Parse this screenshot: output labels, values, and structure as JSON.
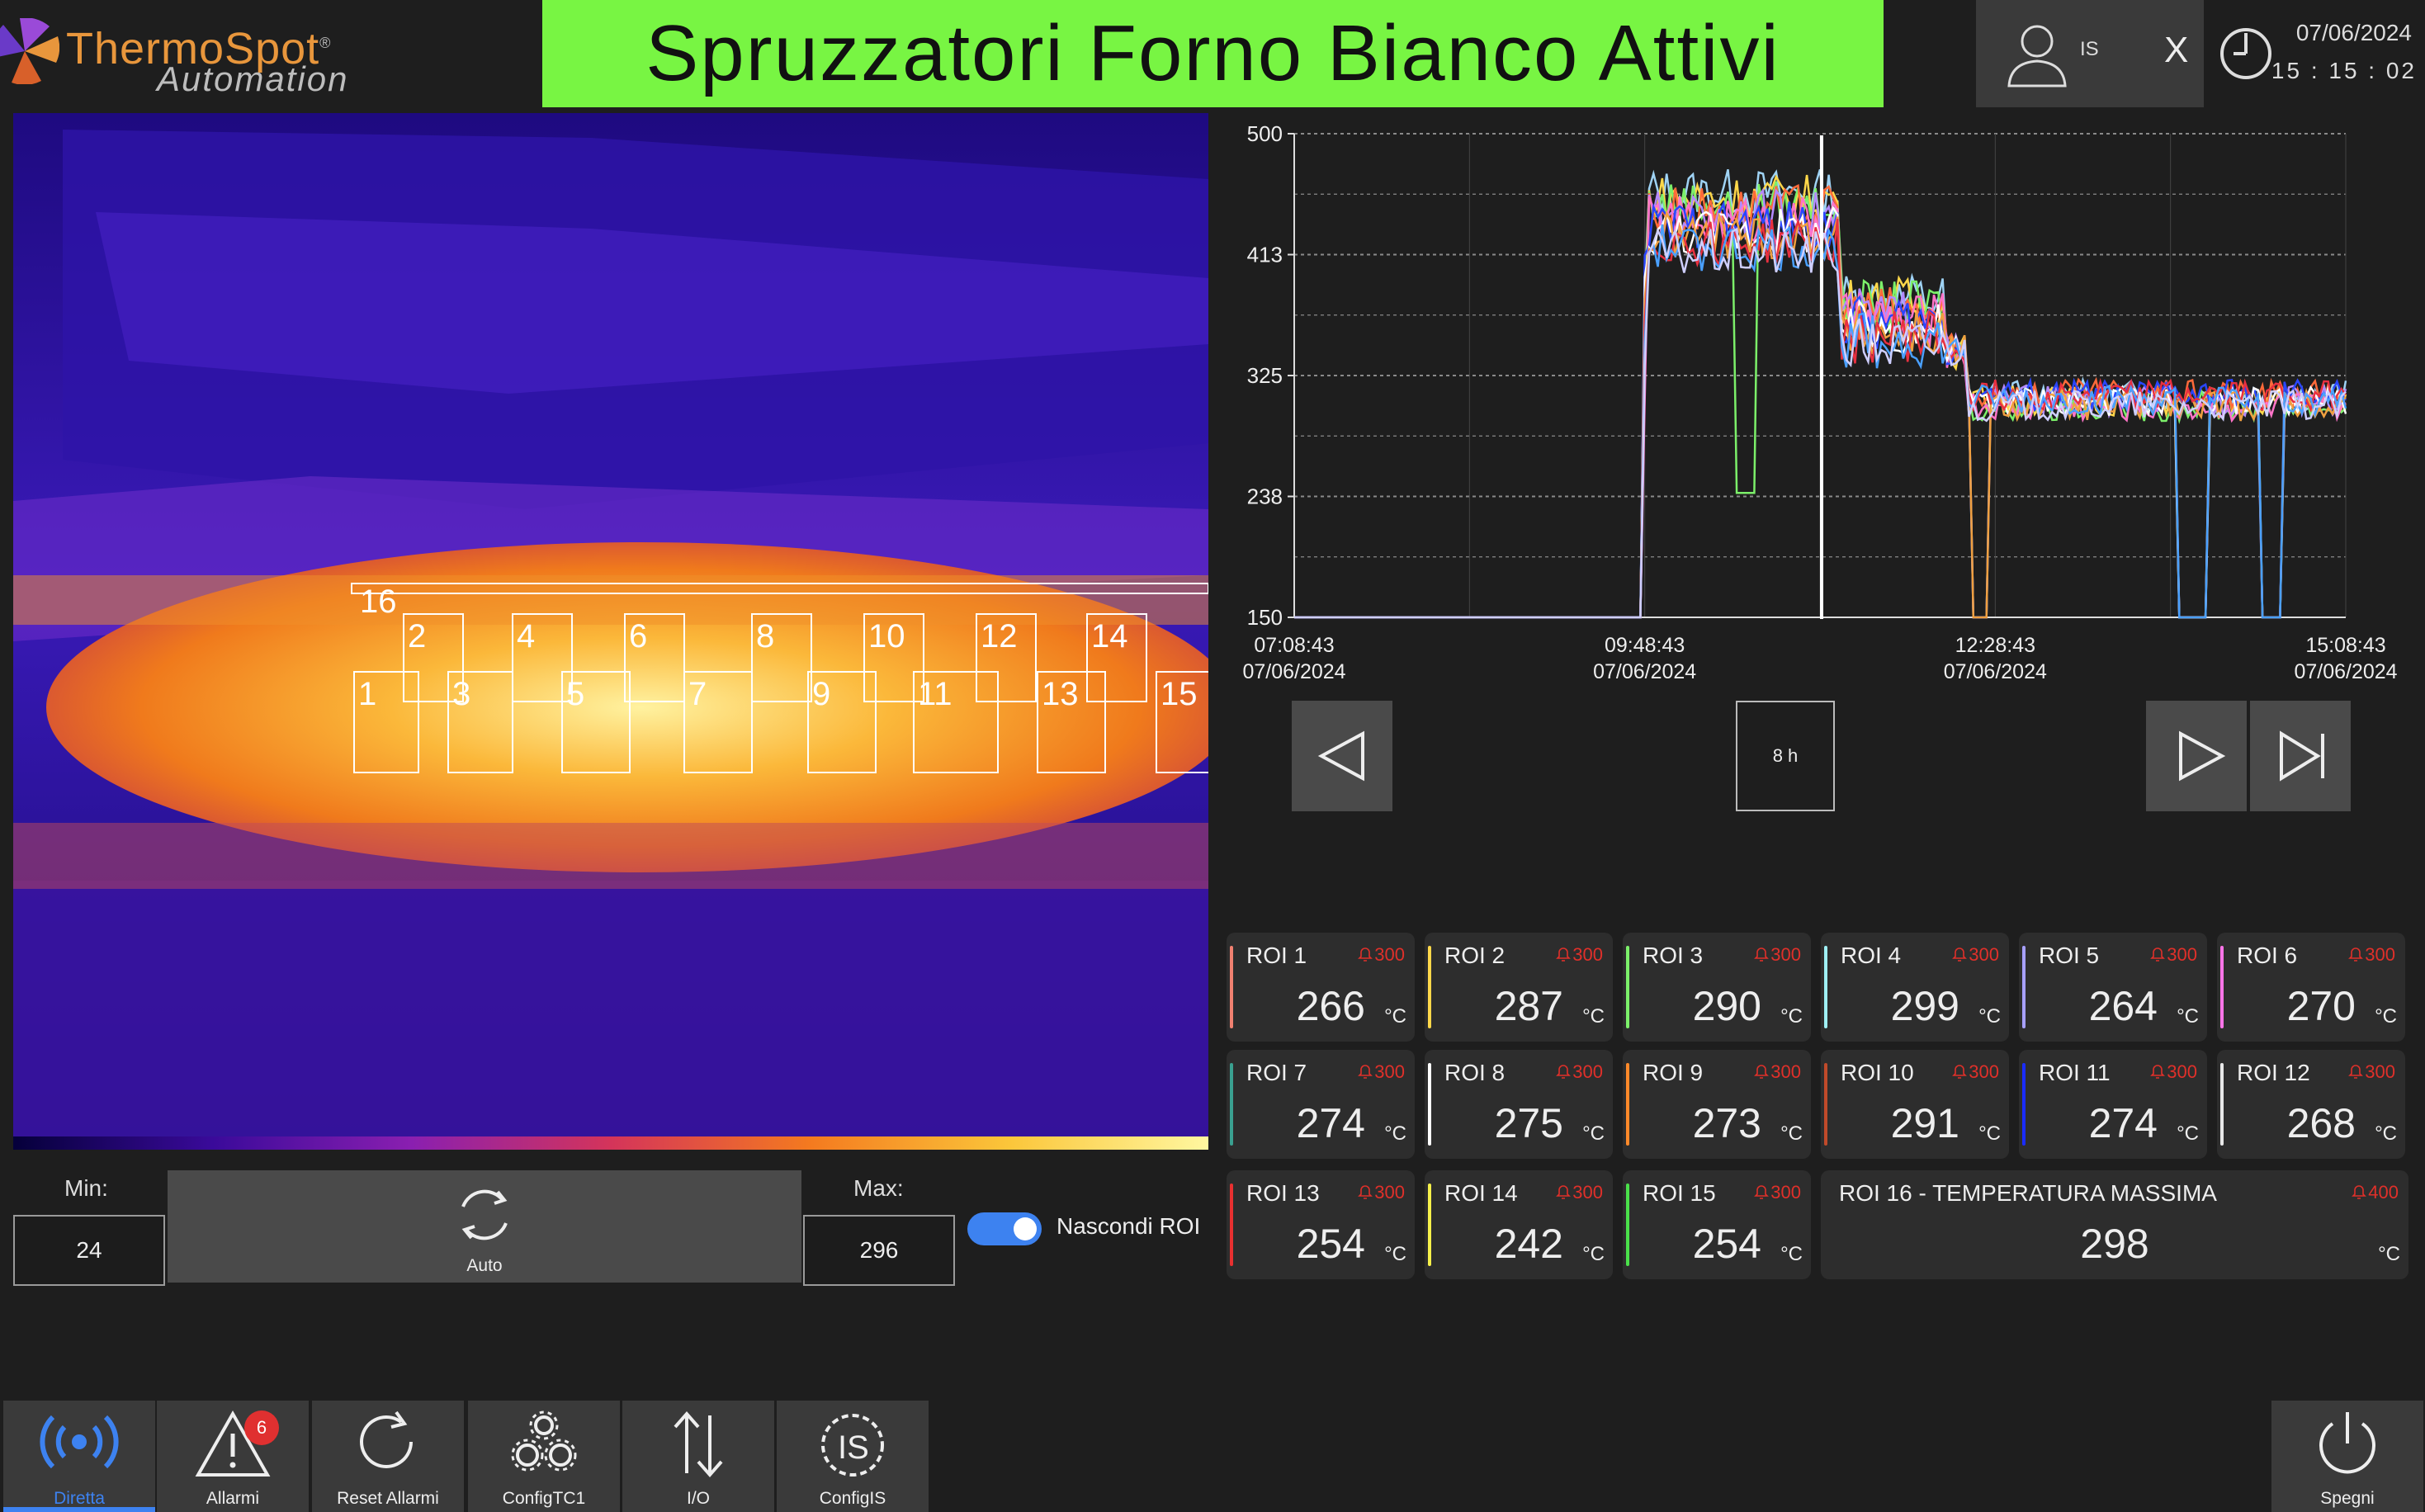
{
  "header": {
    "brand": "ThermoSpot",
    "brand_mark": "®",
    "subtitle": "Automation",
    "title": "Spruzzatori Forno Bianco Attivi",
    "user": "IS",
    "close_label": "X",
    "date": "07/06/2024",
    "time": "15 : 15 : 02"
  },
  "thermal": {
    "roi_labels": [
      "16",
      "2",
      "4",
      "6",
      "8",
      "10",
      "12",
      "14",
      "1",
      "3",
      "5",
      "7",
      "9",
      "11",
      "13",
      "15"
    ]
  },
  "range": {
    "min_label": "Min:",
    "min_value": "24",
    "max_label": "Max:",
    "max_value": "296",
    "auto_label": "Auto",
    "hide_roi_label": "Nascondi ROI",
    "hide_roi_on": true
  },
  "chart_data": {
    "type": "line",
    "ylim": [
      150,
      500
    ],
    "yticks": [
      "500",
      "413",
      "325",
      "238",
      "150"
    ],
    "xticks": [
      {
        "time": "07:08:43",
        "date": "07/06/2024"
      },
      {
        "time": "09:48:43",
        "date": "07/06/2024"
      },
      {
        "time": "12:28:43",
        "date": "07/06/2024"
      },
      {
        "time": "15:08:43",
        "date": "07/06/2024"
      }
    ],
    "grid": true,
    "colors": [
      "#9fd3f5",
      "#ffd84a",
      "#7cf06a",
      "#ff6a3a",
      "#b48aff",
      "#ff74c8",
      "#2a46ff",
      "#ffffff",
      "#f0a040",
      "#e83040",
      "#4aa0ff",
      "#cfcfff"
    ]
  },
  "nav": {
    "range_label": "8 h"
  },
  "rois": [
    {
      "name": "ROI 1",
      "alarm": "300",
      "value": "266",
      "unit": "°C",
      "color": "#f08070"
    },
    {
      "name": "ROI 2",
      "alarm": "300",
      "value": "287",
      "unit": "°C",
      "color": "#ffd84a"
    },
    {
      "name": "ROI 3",
      "alarm": "300",
      "value": "290",
      "unit": "°C",
      "color": "#7cf06a"
    },
    {
      "name": "ROI 4",
      "alarm": "300",
      "value": "299",
      "unit": "°C",
      "color": "#9ff0f5"
    },
    {
      "name": "ROI 5",
      "alarm": "300",
      "value": "264",
      "unit": "°C",
      "color": "#a7a0ff"
    },
    {
      "name": "ROI 6",
      "alarm": "300",
      "value": "270",
      "unit": "°C",
      "color": "#ff74e8"
    },
    {
      "name": "ROI 7",
      "alarm": "300",
      "value": "274",
      "unit": "°C",
      "color": "#3aa090"
    },
    {
      "name": "ROI 8",
      "alarm": "300",
      "value": "275",
      "unit": "°C",
      "color": "#ffffff"
    },
    {
      "name": "ROI 9",
      "alarm": "300",
      "value": "273",
      "unit": "°C",
      "color": "#ff8a2a"
    },
    {
      "name": "ROI 10",
      "alarm": "300",
      "value": "291",
      "unit": "°C",
      "color": "#c04a2a"
    },
    {
      "name": "ROI 11",
      "alarm": "300",
      "value": "274",
      "unit": "°C",
      "color": "#1a2cff"
    },
    {
      "name": "ROI 12",
      "alarm": "300",
      "value": "268",
      "unit": "°C",
      "color": "#e8e8e8"
    },
    {
      "name": "ROI 13",
      "alarm": "300",
      "value": "254",
      "unit": "°C",
      "color": "#e83030"
    },
    {
      "name": "ROI 14",
      "alarm": "300",
      "value": "242",
      "unit": "°C",
      "color": "#f5f04a"
    },
    {
      "name": "ROI 15",
      "alarm": "300",
      "value": "254",
      "unit": "°C",
      "color": "#4ae04a"
    },
    {
      "name": "ROI 16 - TEMPERATURA MASSIMA",
      "alarm": "400",
      "value": "298",
      "unit": "°C",
      "color": ""
    }
  ],
  "toolbar": {
    "diretta": "Diretta",
    "allarmi": "Allarmi",
    "allarmi_badge": "6",
    "reset": "Reset Allarmi",
    "configtc1": "ConfigTC1",
    "io": "I/O",
    "configis": "ConfigIS",
    "spegni": "Spegni"
  },
  "colors": {
    "accent": "#3d82f0",
    "title_bg": "#78f543",
    "alarm": "#e0302a"
  }
}
